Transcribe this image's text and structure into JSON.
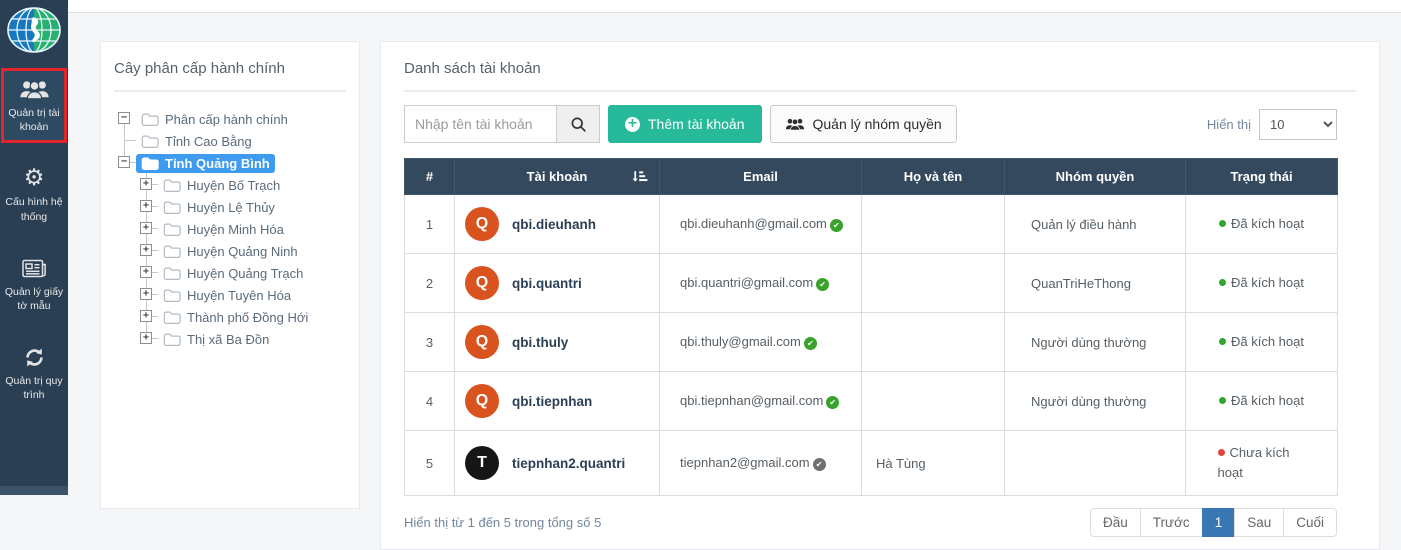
{
  "colors": {
    "sidebar_bg": "#2A3F54",
    "sidebar_active_border": "#E2262C",
    "accent_green": "#26B99A",
    "table_header_bg": "#34495E",
    "tree_selected_bg": "#3D9BF0",
    "avatar_orange": "#D9531E",
    "avatar_black": "#161616",
    "status_active_dot": "#2EA52E",
    "status_inactive_dot": "#E0443A",
    "pagination_active_bg": "#3876B4"
  },
  "sidebar": {
    "items": [
      {
        "label": "Quản trị tài khoản",
        "icon": "users-icon",
        "active": true
      },
      {
        "label": "Cấu hình hệ thống",
        "icon": "gear-icon",
        "active": false
      },
      {
        "label": "Quản lý giấy tờ mẫu",
        "icon": "newspaper-icon",
        "active": false
      },
      {
        "label": "Quản trị quy trình",
        "icon": "refresh-icon",
        "active": false
      }
    ]
  },
  "tree_panel": {
    "title": "Cây phân cấp hành chính",
    "nodes": [
      {
        "label": "Phân cấp hành chính",
        "slots": [
          "exp-minus-root"
        ],
        "selected": false
      },
      {
        "label": "Tỉnh Cao Bằng",
        "slots": [
          "branch"
        ],
        "selected": false
      },
      {
        "label": "Tỉnh Quảng Bình",
        "slots": [
          "exp-minus-last"
        ],
        "selected": true
      },
      {
        "label": "Huyện Bố Trạch",
        "slots": [
          "none",
          "exp-plus-branch"
        ],
        "selected": false
      },
      {
        "label": "Huyện Lệ Thủy",
        "slots": [
          "none",
          "exp-plus-branch"
        ],
        "selected": false
      },
      {
        "label": "Huyện Minh Hóa",
        "slots": [
          "none",
          "exp-plus-branch"
        ],
        "selected": false
      },
      {
        "label": "Huyện Quảng Ninh",
        "slots": [
          "none",
          "exp-plus-branch"
        ],
        "selected": false
      },
      {
        "label": "Huyện Quảng Trạch",
        "slots": [
          "none",
          "exp-plus-branch"
        ],
        "selected": false
      },
      {
        "label": "Huyện Tuyên Hóa",
        "slots": [
          "none",
          "exp-plus-branch"
        ],
        "selected": false
      },
      {
        "label": "Thành phố Đồng Hới",
        "slots": [
          "none",
          "exp-plus-branch"
        ],
        "selected": false
      },
      {
        "label": "Thị xã Ba Đồn",
        "slots": [
          "none",
          "exp-plus-last"
        ],
        "selected": false
      }
    ]
  },
  "accounts_panel": {
    "title": "Danh sách tài khoản",
    "search": {
      "placeholder": "Nhập tên tài khoản"
    },
    "add_button": "Thêm tài khoản",
    "groups_button": "Quản lý nhóm quyền",
    "page_size": {
      "label": "Hiển thị",
      "value": "10"
    },
    "table": {
      "columns": [
        "#",
        "Tài khoản",
        "Email",
        "Họ và tên",
        "Nhóm quyền",
        "Trạng thái"
      ],
      "rows": [
        {
          "index": "1",
          "avatar_letter": "Q",
          "avatar_color": "orange",
          "account": "qbi.dieuhanh",
          "email": "qbi.dieuhanh@gmail.com",
          "email_check": "green",
          "fullname": "",
          "group": "Quản lý điều hành",
          "status_label": "Đã kích hoạt",
          "status_state": "active"
        },
        {
          "index": "2",
          "avatar_letter": "Q",
          "avatar_color": "orange",
          "account": "qbi.quantri",
          "email": "qbi.quantri@gmail.com",
          "email_check": "green",
          "fullname": "",
          "group": "QuanTriHeThong",
          "status_label": "Đã kích hoạt",
          "status_state": "active"
        },
        {
          "index": "3",
          "avatar_letter": "Q",
          "avatar_color": "orange",
          "account": "qbi.thuly",
          "email": "qbi.thuly@gmail.com",
          "email_check": "green",
          "fullname": "",
          "group": "Người dùng thường",
          "status_label": "Đã kích hoạt",
          "status_state": "active"
        },
        {
          "index": "4",
          "avatar_letter": "Q",
          "avatar_color": "orange",
          "account": "qbi.tiepnhan",
          "email": "qbi.tiepnhan@gmail.com",
          "email_check": "green",
          "fullname": "",
          "group": "Người dùng thường",
          "status_label": "Đã kích hoạt",
          "status_state": "active"
        },
        {
          "index": "5",
          "avatar_letter": "T",
          "avatar_color": "black",
          "account": "tiepnhan2.quantri",
          "email": "tiepnhan2@gmail.com",
          "email_check": "gray",
          "fullname": "Hà Tùng",
          "group": "",
          "status_label": "Chưa kích hoạt",
          "status_state": "inactive"
        }
      ]
    },
    "summary": "Hiển thị từ 1 đến 5 trong tổng số 5",
    "pagination": [
      {
        "label": "Đầu",
        "active": false
      },
      {
        "label": "Trước",
        "active": false
      },
      {
        "label": "1",
        "active": true
      },
      {
        "label": "Sau",
        "active": false
      },
      {
        "label": "Cuối",
        "active": false
      }
    ]
  }
}
